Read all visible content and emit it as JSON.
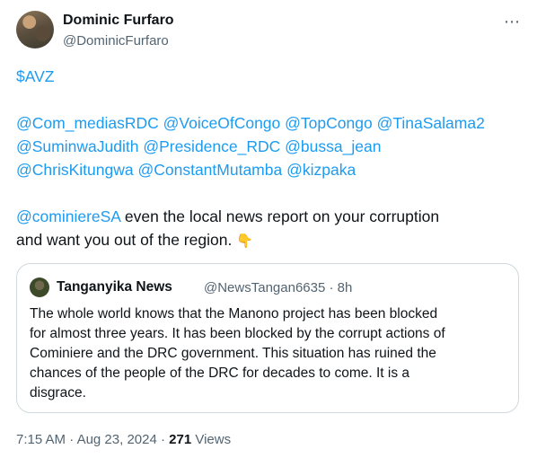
{
  "author": {
    "name": "Dominic Furfaro",
    "handle": "@DominicFurfaro"
  },
  "menu": {
    "more_glyph": "⋯",
    "icon": "more-options-icon"
  },
  "content": {
    "line1": "$AVZ",
    "mentions": [
      [
        "@Com_mediasRDC",
        "@VoiceOfCongo",
        "@TopCongo",
        "@TinaSalama2"
      ],
      [
        "@SuminwaJudith",
        "@Presidence_RDC",
        "@bussa_jean"
      ],
      [
        "@ChrisKitungwa",
        "@ConstantMutamba",
        "@kizpaka"
      ]
    ],
    "reply_mention": "@cominiereSA",
    "reply_text_1": " even the local news report on your corruption",
    "reply_text_2": "and want you out of the region. ",
    "emoji": "👇"
  },
  "quote": {
    "name": "Tanganyika News",
    "handle": "@NewsTangan6635",
    "separator": " · ",
    "time": "8h",
    "lines": [
      "The whole world knows that the Manono project has been blocked",
      "for almost three years. It has been blocked by the corrupt actions of",
      "Cominiere and the DRC government. This situation has ruined the",
      "chances of the people of the DRC for decades to come. It is a",
      "disgrace."
    ]
  },
  "footer": {
    "time": "7:15 AM",
    "dot": " · ",
    "date": "Aug 23, 2024",
    "views_count": "271",
    "views_label": " Views"
  }
}
